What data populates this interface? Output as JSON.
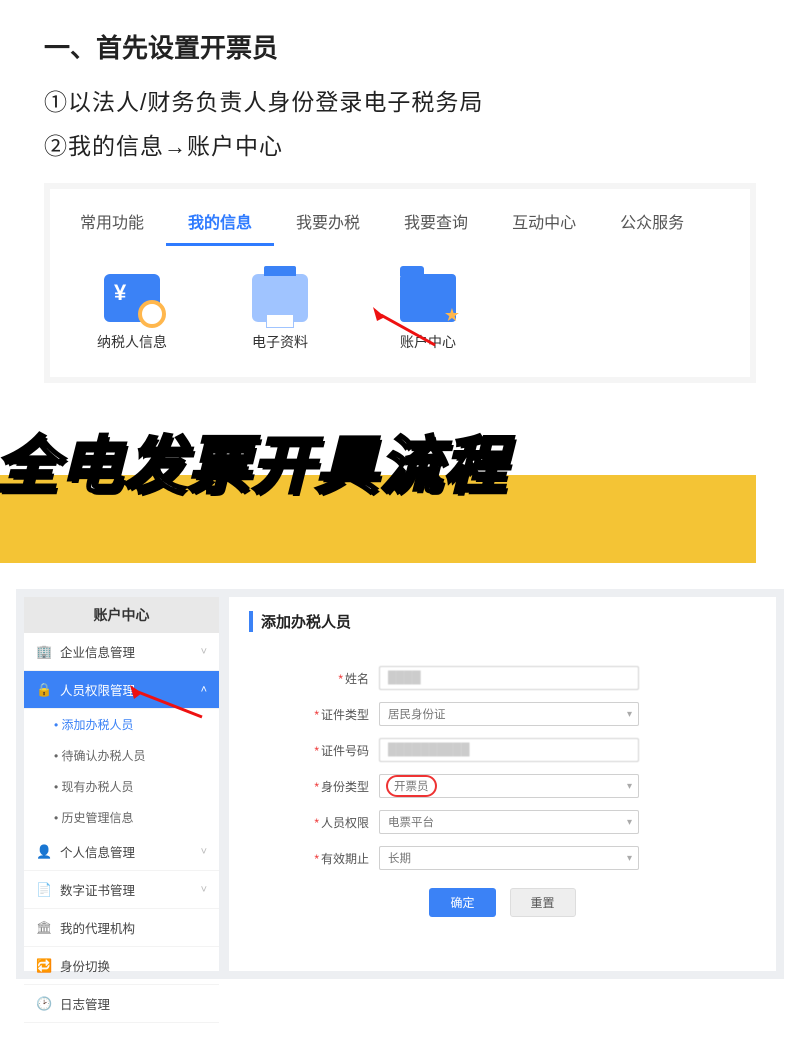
{
  "heading": "一、首先设置开票员",
  "step1": "①以法人/财务负责人身份登录电子税务局",
  "step2_a": "②我的信息",
  "step2_arrow": "→",
  "step2_b": "账户中心",
  "tabs": [
    "常用功能",
    "我的信息",
    "我要办税",
    "我要查询",
    "互动中心",
    "公众服务"
  ],
  "active_tab_index": 1,
  "icons": [
    {
      "label": "纳税人信息",
      "name": "taxpayer-info-icon"
    },
    {
      "label": "电子资料",
      "name": "e-docs-icon"
    },
    {
      "label": "账户中心",
      "name": "account-center-icon"
    }
  ],
  "headline": "全电发票开具流程",
  "sidebar": {
    "title": "账户中心",
    "groups": [
      {
        "label": "企业信息管理",
        "icon": "🏢"
      },
      {
        "label": "人员权限管理",
        "icon": "🔒",
        "active": true,
        "subs": [
          "添加办税人员",
          "待确认办税人员",
          "现有办税人员",
          "历史管理信息"
        ],
        "active_sub_index": 0
      },
      {
        "label": "个人信息管理",
        "icon": "👤"
      },
      {
        "label": "数字证书管理",
        "icon": "📄"
      },
      {
        "label": "我的代理机构",
        "icon": "🏛"
      },
      {
        "label": "身份切换",
        "icon": "🔁"
      },
      {
        "label": "日志管理",
        "icon": "🕑"
      }
    ]
  },
  "form": {
    "title": "添加办税人员",
    "fields": {
      "name": {
        "label": "姓名",
        "value": "",
        "required": true
      },
      "doc_type": {
        "label": "证件类型",
        "value": "居民身份证",
        "required": true,
        "dropdown": true
      },
      "doc_no": {
        "label": "证件号码",
        "value": "",
        "required": true
      },
      "role": {
        "label": "身份类型",
        "value": "开票员",
        "required": true,
        "dropdown": true,
        "circled": true
      },
      "perm": {
        "label": "人员权限",
        "value": "电票平台",
        "required": true,
        "dropdown": true
      },
      "valid": {
        "label": "有效期止",
        "value": "长期",
        "required": true,
        "dropdown": true
      }
    },
    "buttons": {
      "ok": "确定",
      "reset": "重置"
    }
  }
}
